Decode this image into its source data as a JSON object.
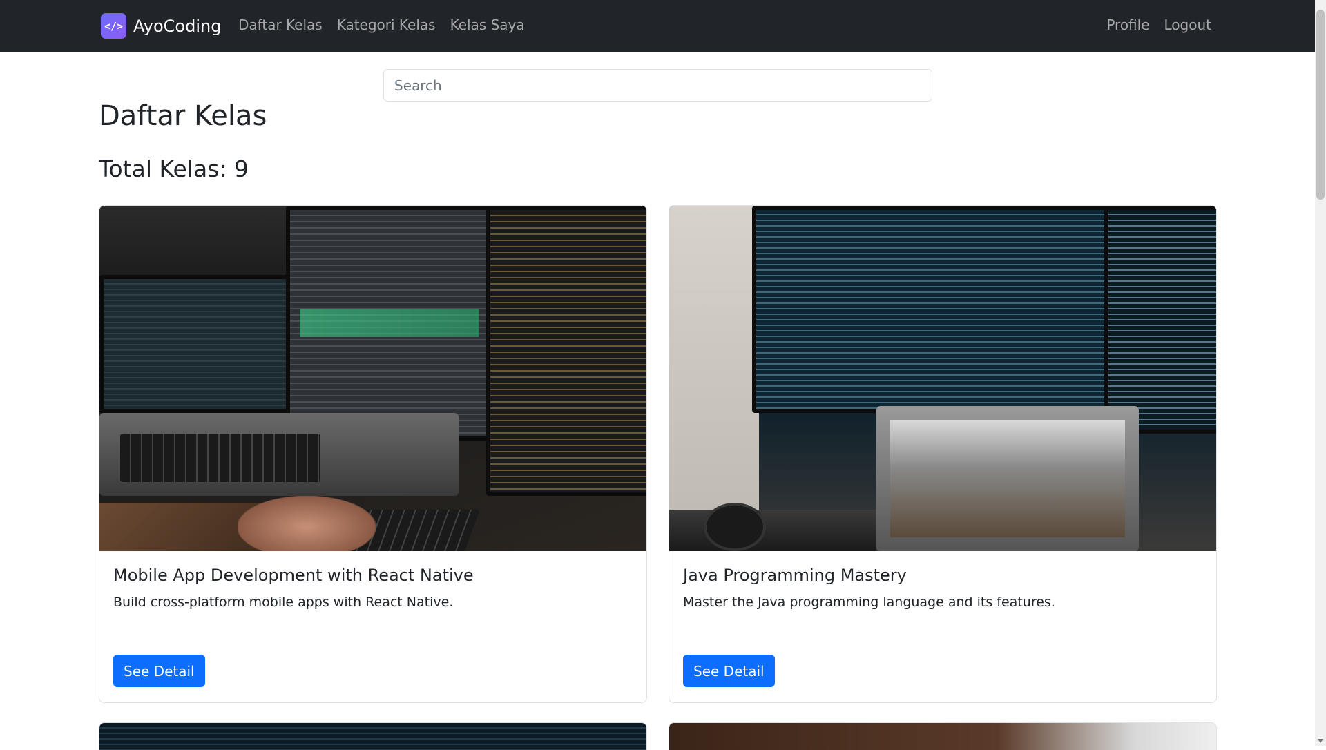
{
  "navbar": {
    "brand_logo_text": "</>",
    "brand_name": "AyoCoding",
    "links": [
      "Daftar Kelas",
      "Kategori Kelas",
      "Kelas Saya"
    ],
    "right_links": [
      "Profile",
      "Logout"
    ]
  },
  "search": {
    "placeholder": "Search",
    "value": ""
  },
  "main": {
    "title": "Daftar Kelas",
    "total_label": "Total Kelas: 9"
  },
  "courses": [
    {
      "title": "Mobile App Development with React Native",
      "description": "Build cross-platform mobile apps with React Native.",
      "button_label": "See Detail"
    },
    {
      "title": "Java Programming Mastery",
      "description": "Master the Java programming language and its features.",
      "button_label": "See Detail"
    }
  ],
  "colors": {
    "navbar_bg": "#212529",
    "primary_button": "#0d6efd",
    "brand_logo": "#6e6cf7"
  }
}
